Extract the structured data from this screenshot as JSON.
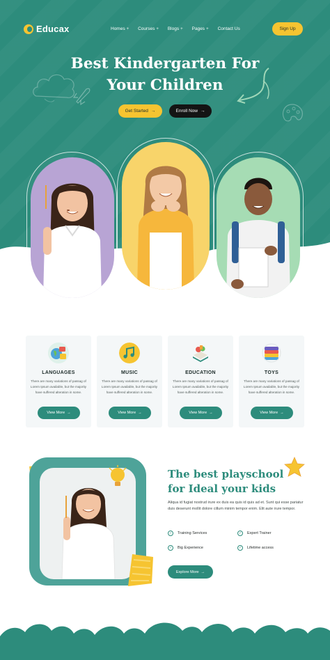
{
  "brand": {
    "name": "Educax"
  },
  "nav": {
    "items": [
      {
        "label": "Homes",
        "has_submenu": true
      },
      {
        "label": "Courses",
        "has_submenu": true
      },
      {
        "label": "Blogs",
        "has_submenu": true
      },
      {
        "label": "Pages",
        "has_submenu": true
      },
      {
        "label": "Contact Us",
        "has_submenu": false
      }
    ],
    "submenu_glyph": "+",
    "signup_label": "Sign Up"
  },
  "hero": {
    "title_line1": "Best Kindergarten For",
    "title_line2": "Your Children",
    "primary_button": "Get Started",
    "secondary_button": "Enroll Now",
    "arrow": "→"
  },
  "features": [
    {
      "title": "LANGUAGES",
      "text": "There are many variations of passag of Lorem Ipsum available, but the majority have suffered alteration in some.",
      "button": "View More",
      "icon": "languages-icon"
    },
    {
      "title": "MUSIC",
      "text": "There are many variations of passag of Lorem Ipsum available, but the majority have suffered alteration in some.",
      "button": "View More",
      "icon": "music-icon"
    },
    {
      "title": "EDUCATION",
      "text": "There are many variations of passag of Lorem Ipsum available, but the majority have suffered alteration in some.",
      "button": "View More",
      "icon": "education-icon"
    },
    {
      "title": "TOYS",
      "text": "There are many variations of passag of Lorem Ipsum available, but the majority have suffered alteration in some.",
      "button": "View More",
      "icon": "toys-icon"
    }
  ],
  "about": {
    "title_line1": "The best playschool",
    "title_line2": "for Ideal your kids",
    "text": "Aliqua id fugiat nostrud irure ex duis ea quis id quis ad et. Sunt qui esse pariatur duis deserunt mollit dolore cillum minim tempor enim. Elit aute irure tempor.",
    "items": [
      "Training Services",
      "Expert Trainer",
      "Big Experience",
      "Lifetime access"
    ],
    "check_glyph": "✓",
    "button": "Explore More"
  },
  "colors": {
    "primary": "#2d8c7c",
    "accent": "#f6c431",
    "dark": "#141414",
    "card_bg": "#f4f7f8"
  }
}
